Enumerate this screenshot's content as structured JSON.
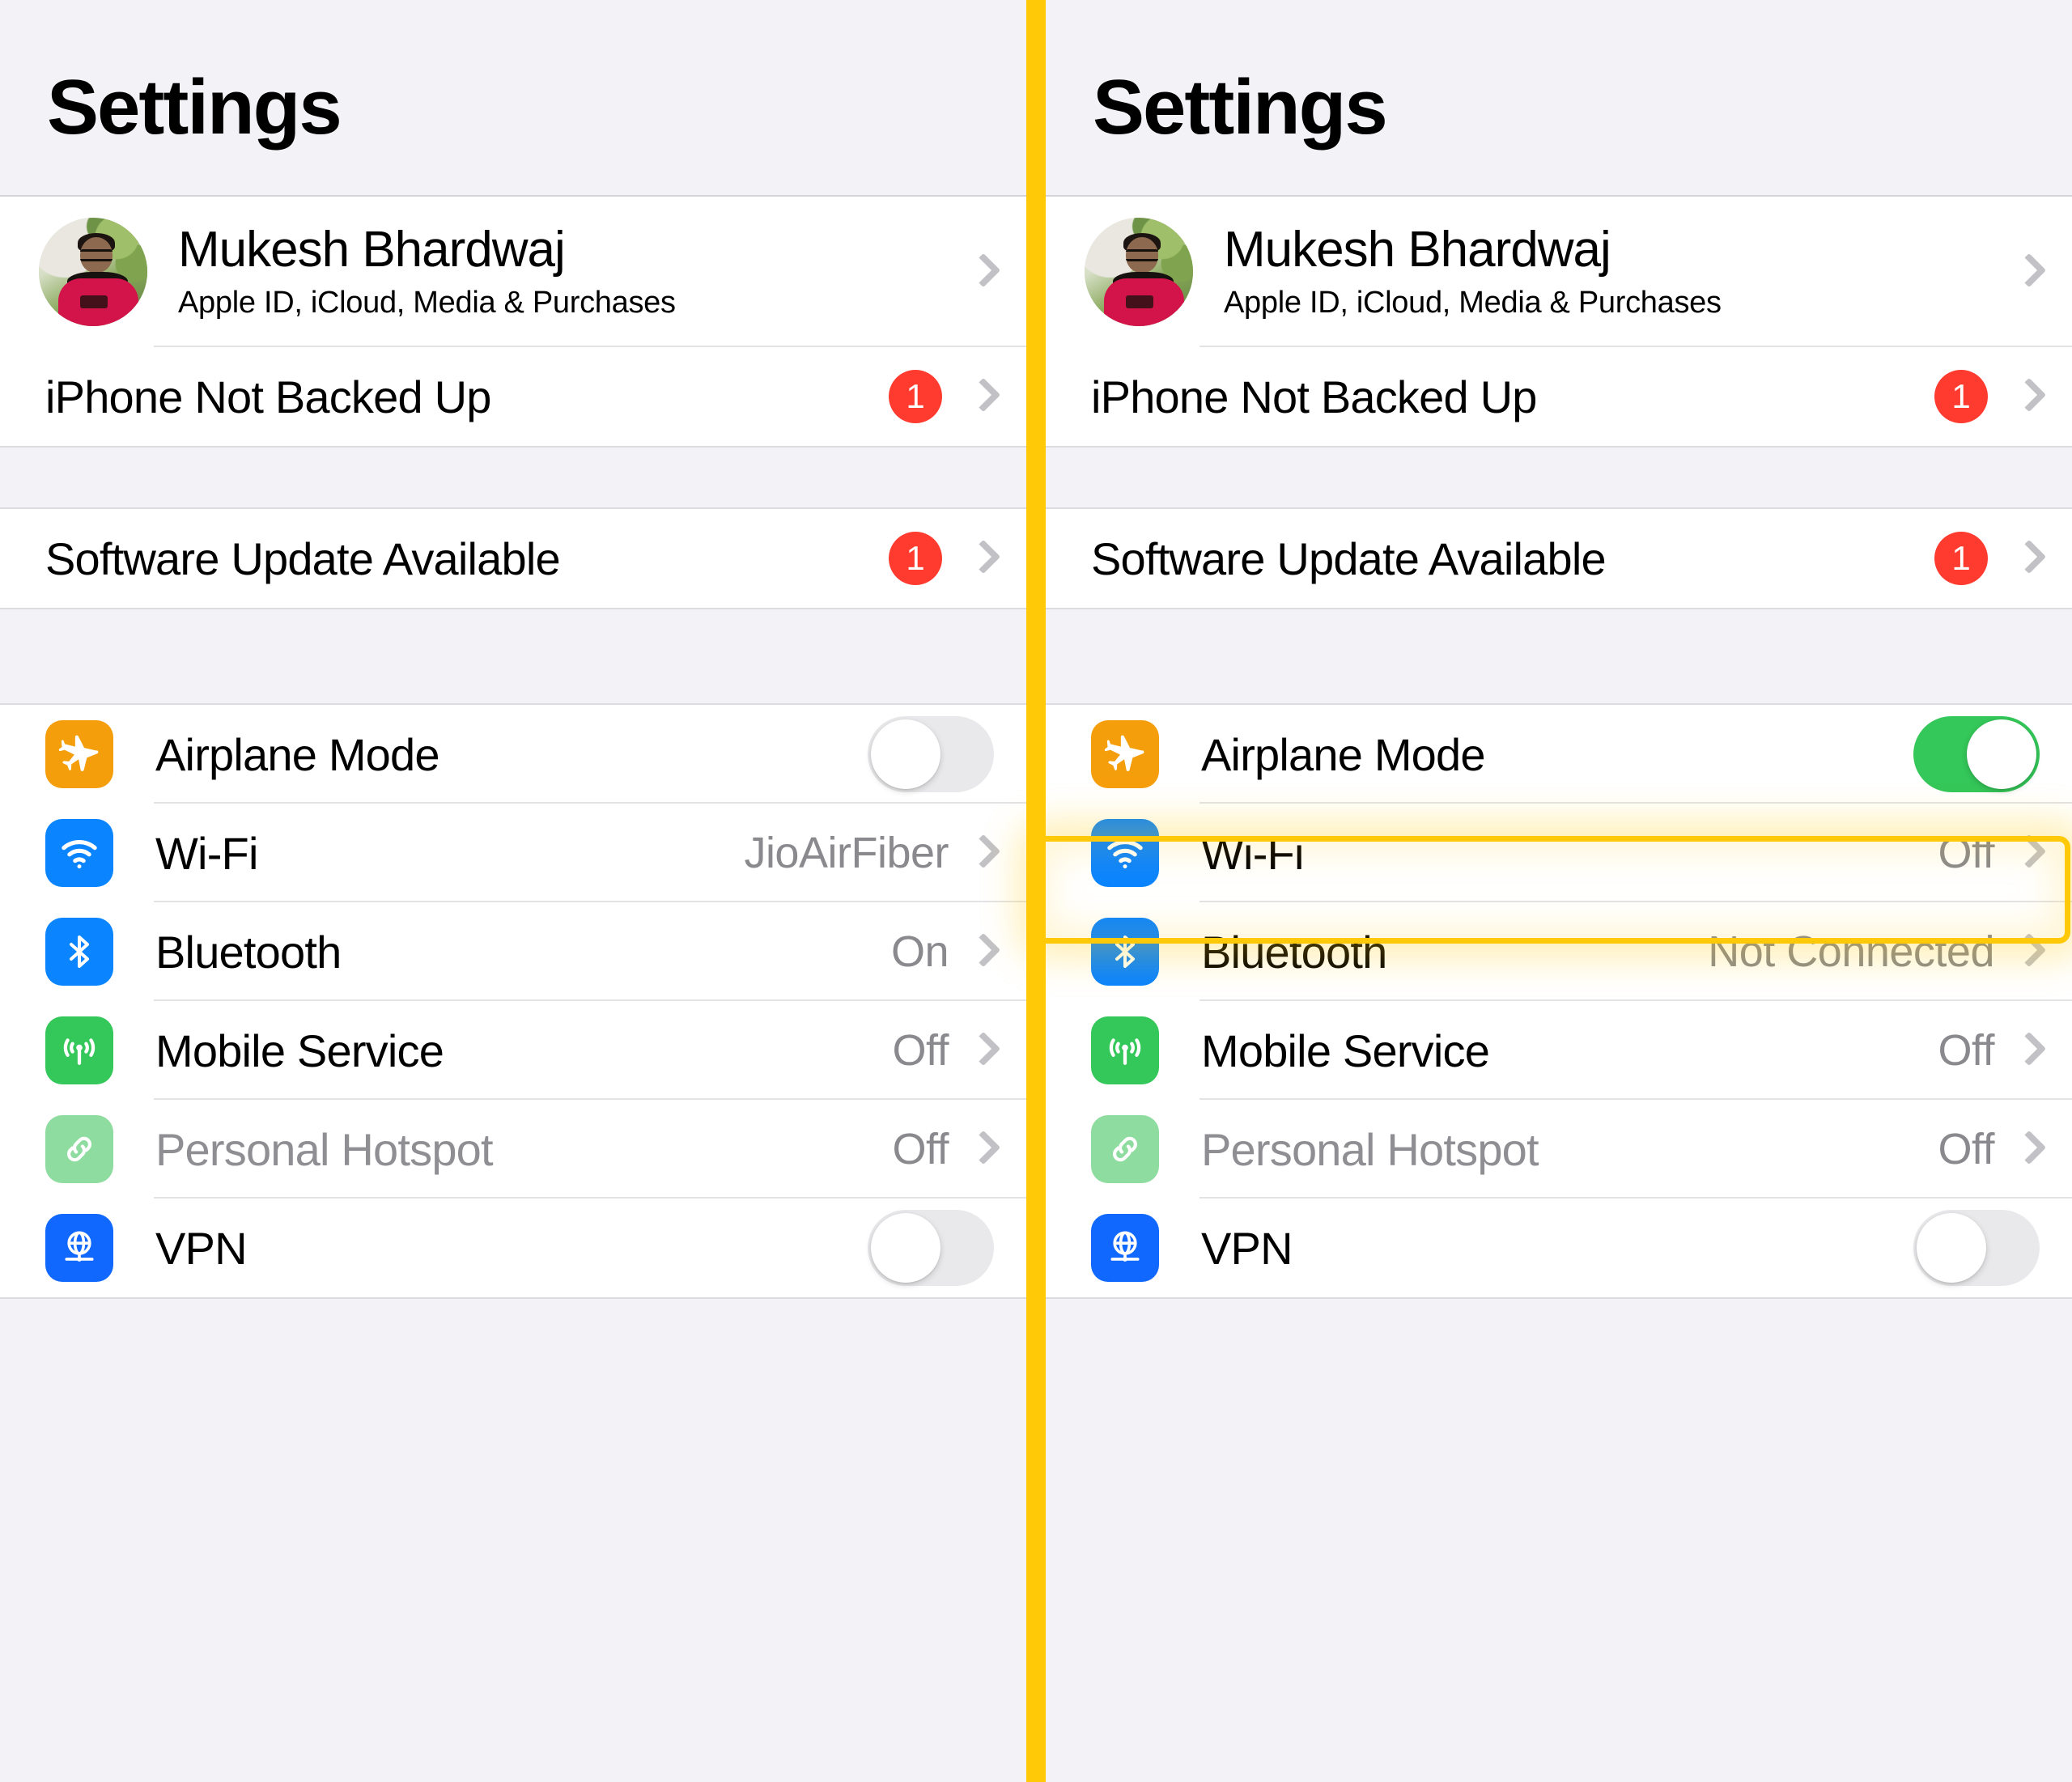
{
  "colors": {
    "divider_yellow": "#FFC907",
    "highlight_border": "#FFC907",
    "badge_red": "#FF3B30",
    "toggle_on_green": "#34C759",
    "toggle_off_gray": "#E9E9EB",
    "page_background": "#F2F2F7",
    "row_background": "#FFFFFF",
    "value_gray": "#8A8A8E",
    "icon_orange": "#F59E0B",
    "icon_blue": "#0A84FF",
    "icon_green": "#34C759",
    "icon_green_dim": "#8FDCA0"
  },
  "panels": [
    {
      "id": "before",
      "header": {
        "title": "Settings"
      },
      "account": {
        "name": "Mukesh Bhardwaj",
        "subtitle": "Apple ID, iCloud, Media & Purchases",
        "avatar_name": "profile-photo",
        "chevron": "chevron-right-icon"
      },
      "backup_row": {
        "label": "iPhone Not Backed Up",
        "badge": "1",
        "chevron": "chevron-right-icon"
      },
      "update_row": {
        "label": "Software Update Available",
        "badge": "1",
        "chevron": "chevron-right-icon"
      },
      "connectivity": [
        {
          "label": "Airplane Mode",
          "icon": "airplane-icon",
          "control": "toggle",
          "toggle_state": "off",
          "value": ""
        },
        {
          "label": "Wi-Fi",
          "icon": "wifi-icon",
          "control": "value",
          "value": "JioAirFiber"
        },
        {
          "label": "Bluetooth",
          "icon": "bluetooth-icon",
          "control": "value",
          "value": "On"
        },
        {
          "label": "Mobile Service",
          "icon": "mobile-service-icon",
          "control": "value",
          "value": "Off"
        },
        {
          "label": "Personal Hotspot",
          "icon": "personal-hotspot-icon",
          "control": "value",
          "value": "Off",
          "disabled": true
        },
        {
          "label": "VPN",
          "icon": "vpn-icon",
          "control": "toggle",
          "toggle_state": "off",
          "value": ""
        }
      ]
    },
    {
      "id": "after",
      "header": {
        "title": "Settings"
      },
      "account": {
        "name": "Mukesh Bhardwaj",
        "subtitle": "Apple ID, iCloud, Media & Purchases",
        "avatar_name": "profile-photo",
        "chevron": "chevron-right-icon"
      },
      "backup_row": {
        "label": "iPhone Not Backed Up",
        "badge": "1",
        "chevron": "chevron-right-icon"
      },
      "update_row": {
        "label": "Software Update Available",
        "badge": "1",
        "chevron": "chevron-right-icon"
      },
      "connectivity": [
        {
          "label": "Airplane Mode",
          "icon": "airplane-icon",
          "control": "toggle",
          "toggle_state": "on",
          "value": "",
          "highlighted": true
        },
        {
          "label": "Wi-Fi",
          "icon": "wifi-icon",
          "control": "value",
          "value": "Off"
        },
        {
          "label": "Bluetooth",
          "icon": "bluetooth-icon",
          "control": "value",
          "value": "Not Connected"
        },
        {
          "label": "Mobile Service",
          "icon": "mobile-service-icon",
          "control": "value",
          "value": "Off"
        },
        {
          "label": "Personal Hotspot",
          "icon": "personal-hotspot-icon",
          "control": "value",
          "value": "Off",
          "disabled": true
        },
        {
          "label": "VPN",
          "icon": "vpn-icon",
          "control": "toggle",
          "toggle_state": "off",
          "value": ""
        }
      ]
    }
  ]
}
